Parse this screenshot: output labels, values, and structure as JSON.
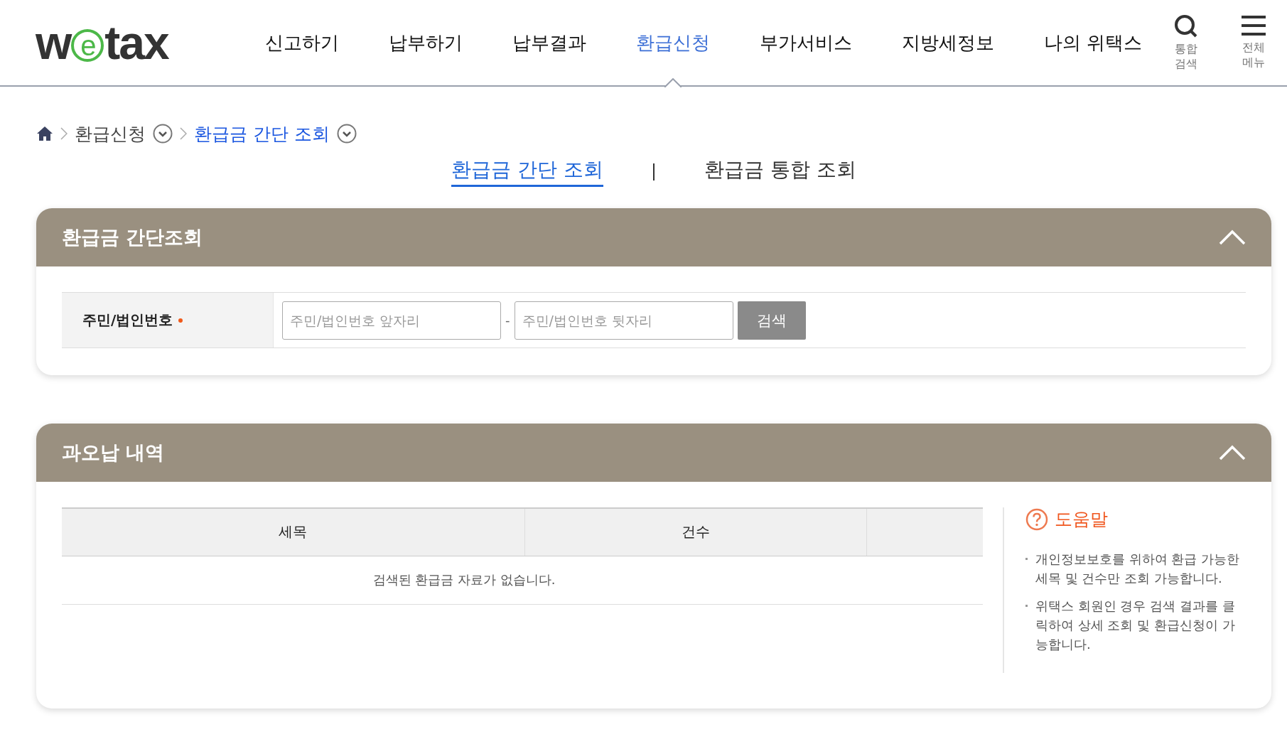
{
  "logo": {
    "before": "w",
    "circled": "e",
    "after": "tax"
  },
  "nav": [
    {
      "label": "신고하기",
      "selected": false
    },
    {
      "label": "납부하기",
      "selected": false
    },
    {
      "label": "납부결과",
      "selected": false
    },
    {
      "label": "환급신청",
      "selected": true
    },
    {
      "label": "부가서비스",
      "selected": false
    },
    {
      "label": "지방세정보",
      "selected": false
    },
    {
      "label": "나의 위택스",
      "selected": false
    }
  ],
  "utilities": [
    {
      "kind": "search",
      "label": "통합검색"
    },
    {
      "kind": "menu",
      "label": "전체메뉴"
    }
  ],
  "breadcrumb": [
    {
      "label": "환급신청",
      "current": false
    },
    {
      "label": "환급금 간단 조회",
      "current": true
    }
  ],
  "tabs": [
    {
      "label": "환급금 간단 조회",
      "selected": true
    },
    {
      "label": "환급금 통합 조회",
      "selected": false
    }
  ],
  "search_panel": {
    "title": "환급금 간단조회",
    "expanded": true,
    "field_label": "주민/법인번호",
    "required": true,
    "front_placeholder": "주민/법인번호 앞자리",
    "separator": "-",
    "back_placeholder": "주민/법인번호 뒷자리",
    "button": "검색"
  },
  "result_panel": {
    "title": "과오납 내역",
    "expanded": true,
    "table": {
      "columns": [
        "세목",
        "건수"
      ],
      "empty_message": "검색된 환급금 자료가 없습니다."
    },
    "help": {
      "title": "도움말",
      "items": [
        "개인정보보호를 위하여 환급 가능한 세목 및 건수만 조회 가능합니다.",
        "위택스 회원인 경우 검색 결과를 클릭하여 상세 조회 및 환급신청이 가능합니다."
      ]
    }
  }
}
